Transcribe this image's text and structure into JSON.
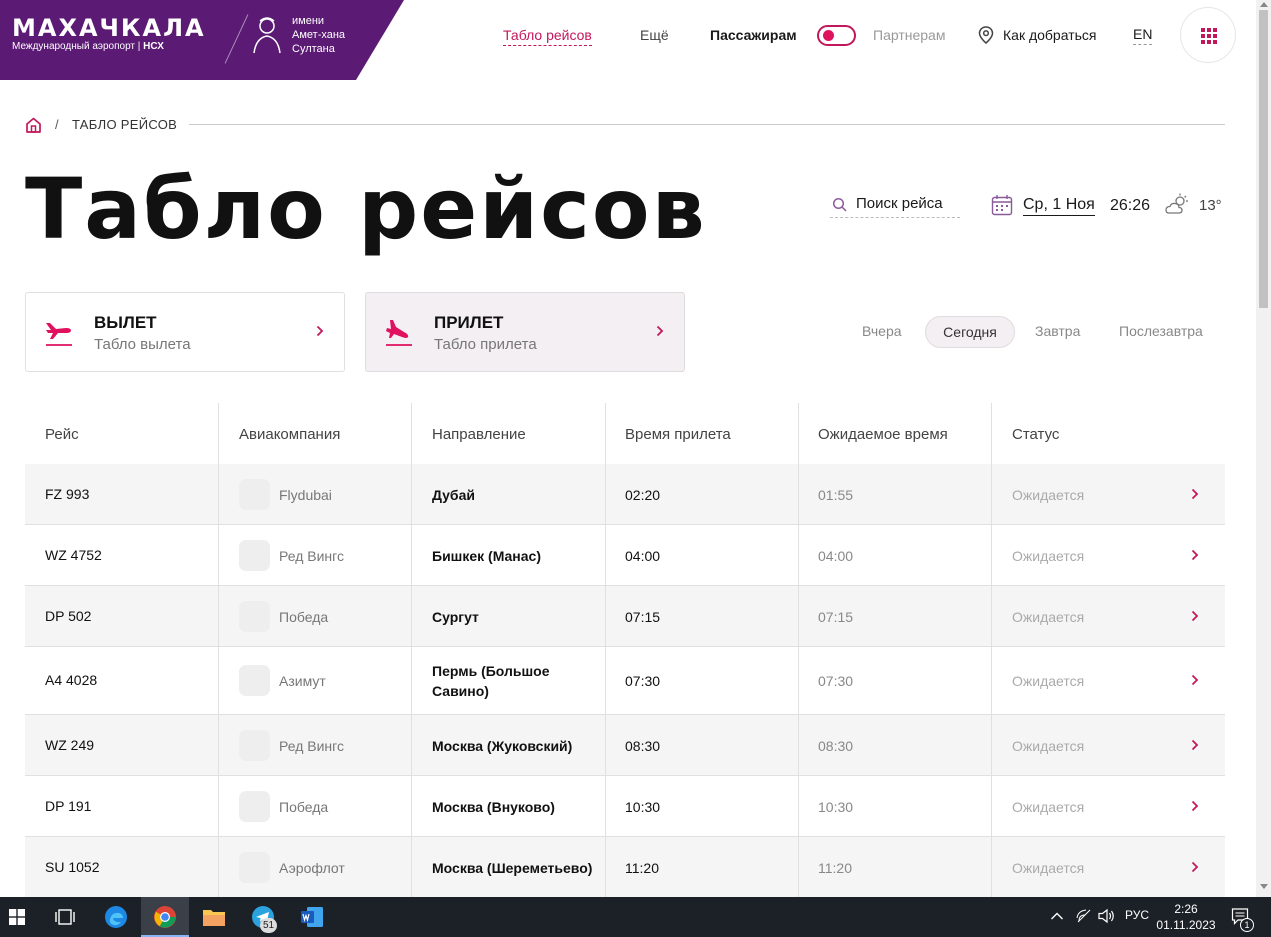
{
  "header": {
    "logo_title": "МАХАЧКАЛА",
    "logo_subtitle": "Международный аэропорт",
    "logo_partner": "НСХ",
    "named_after": [
      "имени",
      "Амет-хана",
      "Султана"
    ],
    "nav": {
      "board": "Табло рейсов",
      "more": "Ещё",
      "passengers": "Пассажирам",
      "partners": "Партнерам",
      "how_to_get": "Как добраться",
      "lang": "EN"
    }
  },
  "breadcrumb": {
    "current": "ТАБЛО РЕЙСОВ",
    "separator": "/"
  },
  "page_title": "Табло рейсов",
  "toolbar": {
    "search_label": "Поиск рейса",
    "date": "Ср, 1 Ноя",
    "time": "26:26",
    "temperature": "13°"
  },
  "direction_cards": {
    "departure": {
      "title": "ВЫЛЕТ",
      "subtitle": "Табло вылета"
    },
    "arrival": {
      "title": "ПРИЛЕТ",
      "subtitle": "Табло прилета"
    }
  },
  "days": {
    "yesterday": "Вчера",
    "today": "Сегодня",
    "tomorrow": "Завтра",
    "after_tomorrow": "Послезавтра"
  },
  "table": {
    "columns": [
      "Рейс",
      "Авиакомпания",
      "Направление",
      "Время прилета",
      "Ожидаемое время",
      "Статус"
    ],
    "rows": [
      {
        "flight": "FZ 993",
        "airline": "Flydubai",
        "destination": "Дубай",
        "time": "02:20",
        "expected": "01:55",
        "status": "Ожидается"
      },
      {
        "flight": "WZ 4752",
        "airline": "Ред Вингс",
        "destination": "Бишкек (Манас)",
        "time": "04:00",
        "expected": "04:00",
        "status": "Ожидается"
      },
      {
        "flight": "DP 502",
        "airline": "Победа",
        "destination": "Сургут",
        "time": "07:15",
        "expected": "07:15",
        "status": "Ожидается"
      },
      {
        "flight": "A4 4028",
        "airline": "Азимут",
        "destination": "Пермь (Большое Савино)",
        "time": "07:30",
        "expected": "07:30",
        "status": "Ожидается"
      },
      {
        "flight": "WZ 249",
        "airline": "Ред Вингс",
        "destination": "Москва (Жуковский)",
        "time": "08:30",
        "expected": "08:30",
        "status": "Ожидается"
      },
      {
        "flight": "DP 191",
        "airline": "Победа",
        "destination": "Москва (Внуково)",
        "time": "10:30",
        "expected": "10:30",
        "status": "Ожидается"
      },
      {
        "flight": "SU 1052",
        "airline": "Аэрофлот",
        "destination": "Москва (Шереметьево)",
        "time": "11:20",
        "expected": "11:20",
        "status": "Ожидается"
      }
    ]
  },
  "taskbar": {
    "lang": "РУС",
    "clock_time": "2:26",
    "clock_date": "01.11.2023",
    "telegram_badge": "51",
    "notification_badge": "1"
  },
  "colors": {
    "brand_purple": "#5b1a74",
    "accent_pink": "#e0115f"
  }
}
